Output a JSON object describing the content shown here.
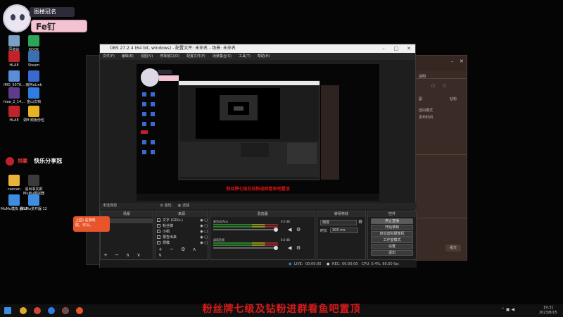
{
  "banner": {
    "title": "图楼冠名",
    "name": "Fe钉"
  },
  "desktop_icons": [
    {
      "label": "回收站",
      "color": "#7aa0c8"
    },
    {
      "label": "KOOK",
      "color": "#2aa55a"
    },
    {
      "label": "HLAE",
      "color": "#c0242a"
    },
    {
      "label": "Steam",
      "color": "#3b6fb0"
    },
    {
      "label": "IMG_5076...",
      "color": "#5a8ed8"
    },
    {
      "label": "南阿eLink",
      "color": "#3a6ad0"
    },
    {
      "label": "hlae_2_14...",
      "color": "#5d3c8c"
    },
    {
      "label": "金山文档",
      "color": "#2f7de1"
    },
    {
      "label": "HLAE",
      "color": "#c0242a"
    },
    {
      "label": "调ff.频板份包",
      "color": "#e6b422"
    },
    {
      "label": "cancan",
      "color": "#e9b33a"
    },
    {
      "label": "退出事实即 MuMu模拟器",
      "color": "#3a3a3a"
    },
    {
      "label": "MuMu模拟 器12",
      "color": "#3d8ee0"
    },
    {
      "label": "MuMu多开器 12",
      "color": "#3d8ee0"
    }
  ],
  "gift": {
    "red": "绑赢",
    "brand": "快乐分享冠",
    "share": "快乐分享冠"
  },
  "obs": {
    "window_title": "OBS 27.2.4 (64 bit, windows) - 配置文件: 未命名 - 场景: 未命名",
    "menu": [
      "文件(F)",
      "编辑(E)",
      "视图(V)",
      "停靠窗口(D)",
      "配置文件(P)",
      "场景集合(S)",
      "工具(T)",
      "帮助(H)"
    ],
    "preview_caption": "粉丝牌七级及钻粉进群看鱼吧置顶",
    "no_source": "未选择源",
    "props": "属性",
    "filters": "滤镜",
    "docks": {
      "scenes": {
        "title": "场景",
        "items": [
          "场景"
        ]
      },
      "sources": {
        "title": "来源",
        "items": [
          "文字 (GDI+)",
          "粉丝牌",
          "小组",
          "报告出来",
          "规模"
        ]
      },
      "mixer": {
        "title": "混音器",
        "tracks": [
          {
            "name": "麦克风/Aux",
            "db": "0.0 dB"
          },
          {
            "name": "桌面音频",
            "db": "0.0 dB"
          }
        ]
      },
      "transitions": {
        "title": "转场特效",
        "type": "渐变",
        "duration_label": "时长",
        "duration": "300 ms"
      },
      "controls": {
        "title": "控件",
        "buttons": [
          "停止直播",
          "开始录制",
          "启动虚拟摄像机",
          "工作室模式",
          "设置",
          "退出"
        ]
      }
    },
    "status": {
      "live_label": "LIVE:",
      "live_time": "00:00:00",
      "rec_label": "REC:",
      "rec_time": "00:00:00",
      "cpu": "CPU: 0.4%, 60.00 fps"
    }
  },
  "orange_note": "上园) 名游戏",
  "orange_note2": "院，可以，",
  "right_window": {
    "tab1": "副",
    "tab2": "钻粉",
    "lines": [
      "说明",
      "自由模式",
      "发布时间"
    ],
    "button": "提交"
  },
  "subtitle": "粉丝牌七级及钻粉进群看鱼吧置顶",
  "taskbar": {
    "time": "19:31",
    "date": "2023/8/15"
  }
}
